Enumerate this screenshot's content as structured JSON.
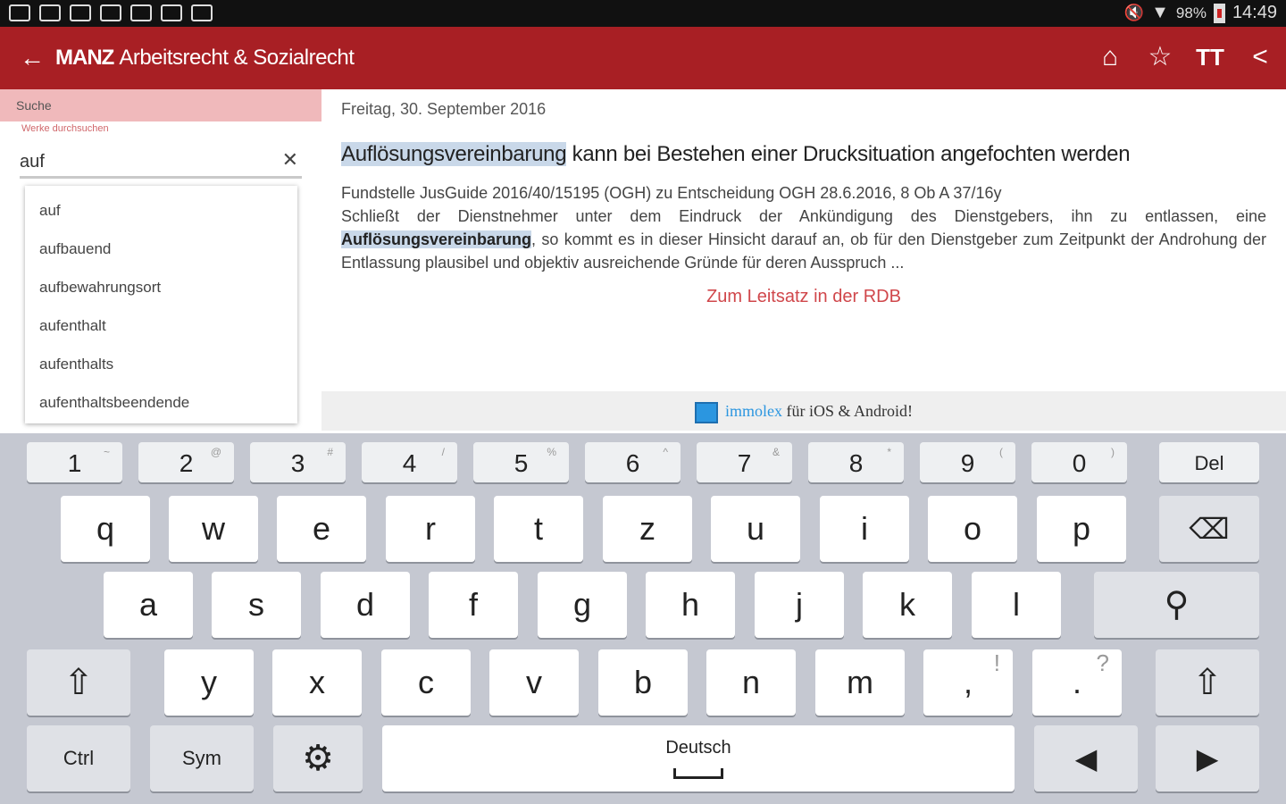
{
  "statusbar": {
    "battery": "98%",
    "time": "14:49"
  },
  "appbar": {
    "back_icon": "arrow-left-icon",
    "logo": "MANZ",
    "title": "Arbeitsrecht & Sozialrecht",
    "actions": [
      "home-icon",
      "star-icon",
      "text-size-icon",
      "share-icon"
    ]
  },
  "search": {
    "header": "Suche",
    "hint": "Werke durchsuchen",
    "value": "auf",
    "suggestions": [
      "auf",
      "aufbauend",
      "aufbewahrungsort",
      "aufenthalt",
      "aufenthalts",
      "aufenthaltsbeendende"
    ]
  },
  "article": {
    "date": "Freitag, 30. September 2016",
    "headline_highlight": "Auflösungsvereinbarung",
    "headline_rest": " kann bei Bestehen einer Drucksituation angefochten werden",
    "body_line1": "Fundstelle JusGuide 2016/40/15195 (OGH) zu Entscheidung OGH 28.6.2016, 8 Ob A 37/16y",
    "body_pre": "Schließt der Dienstnehmer unter dem Eindruck der Ankündigung des Dienstgebers, ihn zu entlassen, eine ",
    "body_bold": "Auflösungsvereinbarung",
    "body_post": ", so kommt es in dieser Hinsicht darauf an, ob für den Dienstgeber zum Zeitpunkt der Androhung der Entlassung plausibel und objektiv ausreichende Gründe für deren Ausspruch ...",
    "link": "Zum Leitsatz in der RDB"
  },
  "banner": {
    "brand": "immolex",
    "text": " für iOS & Android!"
  },
  "keyboard": {
    "number_row": [
      {
        "main": "1",
        "sub": "~"
      },
      {
        "main": "2",
        "sub": "@"
      },
      {
        "main": "3",
        "sub": "#"
      },
      {
        "main": "4",
        "sub": "/"
      },
      {
        "main": "5",
        "sub": "%"
      },
      {
        "main": "6",
        "sub": "^"
      },
      {
        "main": "7",
        "sub": "&"
      },
      {
        "main": "8",
        "sub": "*"
      },
      {
        "main": "9",
        "sub": "("
      },
      {
        "main": "0",
        "sub": ")"
      }
    ],
    "del": "Del",
    "row1": [
      "q",
      "w",
      "e",
      "r",
      "t",
      "z",
      "u",
      "i",
      "o",
      "p"
    ],
    "row2": [
      "a",
      "s",
      "d",
      "f",
      "g",
      "h",
      "j",
      "k",
      "l"
    ],
    "row3": [
      "y",
      "x",
      "c",
      "v",
      "b",
      "n",
      "m"
    ],
    "comma": ",",
    "exclaim": "!",
    "period": ".",
    "question": "?",
    "ctrl": "Ctrl",
    "sym": "Sym",
    "language": "Deutsch"
  }
}
